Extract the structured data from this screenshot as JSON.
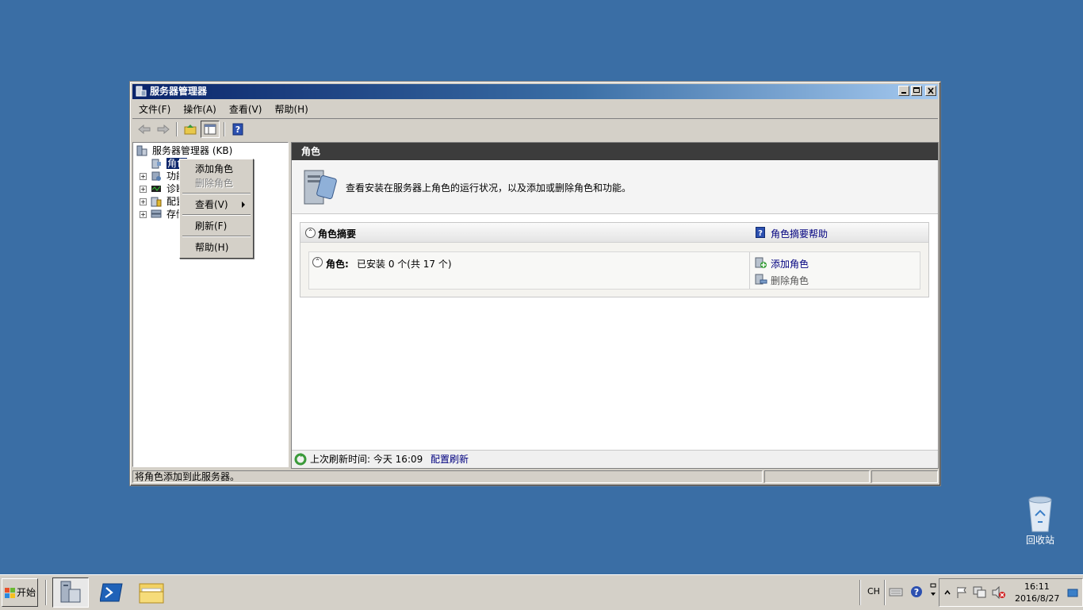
{
  "window": {
    "title": "服务器管理器",
    "buttons": [
      "minimize",
      "maximize",
      "close"
    ]
  },
  "menubar": {
    "items": [
      "文件(F)",
      "操作(A)",
      "查看(V)",
      "帮助(H)"
    ]
  },
  "toolbar": {
    "icons": [
      "back-arrow-icon",
      "forward-arrow-icon",
      "up-folder-icon",
      "show-hide-tree-icon",
      "help-icon"
    ]
  },
  "tree": {
    "root": "服务器管理器 (KB)",
    "items": [
      "角色",
      "功能",
      "诊断",
      "配置",
      "存储"
    ]
  },
  "context_menu": {
    "items": [
      {
        "label": "添加角色",
        "enabled": true
      },
      {
        "label": "删除角色",
        "enabled": false
      },
      {
        "label": "查看(V)",
        "enabled": true,
        "submenu": true
      },
      {
        "label": "刷新(F)",
        "enabled": true
      },
      {
        "label": "帮助(H)",
        "enabled": true
      }
    ]
  },
  "main": {
    "header": "角色",
    "description": "查看安装在服务器上角色的运行状况，以及添加或删除角色和功能。",
    "summary": {
      "title": "角色摘要",
      "help_link": "角色摘要帮助",
      "roles_label": "角色:",
      "roles_status": "已安装 0 个(共 17 个)",
      "actions": {
        "add": "添加角色",
        "remove": "删除角色"
      }
    },
    "footer": {
      "refresh_label": "上次刷新时间: 今天 16:09",
      "configure_link": "配置刷新"
    }
  },
  "statusbar": {
    "text": "将角色添加到此服务器。"
  },
  "taskbar": {
    "start": "开始",
    "tray": {
      "lang": "CH",
      "time": "16:11",
      "date": "2016/8/27"
    }
  },
  "desktop": {
    "recycle_bin": "回收站"
  },
  "colors": {
    "desktop": "#3a6ea5",
    "header": "#3c3c3c",
    "link": "#00007f"
  }
}
